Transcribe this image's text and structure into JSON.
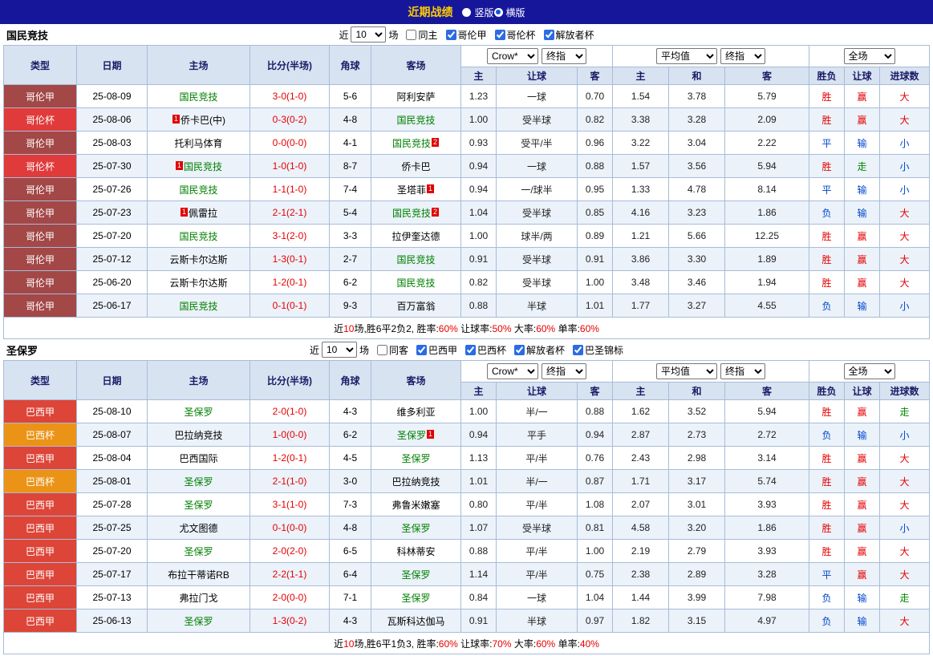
{
  "topbar": {
    "title": "近期战绩",
    "radios": [
      {
        "label": "竖版",
        "selected": false
      },
      {
        "label": "横版",
        "selected": true
      }
    ]
  },
  "columns": {
    "left": [
      "类型",
      "日期",
      "主场",
      "比分(半场)",
      "角球",
      "客场"
    ],
    "selects": {
      "odds_source": "Crow*",
      "odds_time": "终指",
      "avg_source": "平均值",
      "avg_time": "终指",
      "scope": "全场"
    },
    "odds_cols": [
      "主",
      "让球",
      "客"
    ],
    "avg_cols": [
      "主",
      "和",
      "客"
    ],
    "result_cols": [
      "胜负",
      "让球",
      "进球数"
    ]
  },
  "league_colors": {
    "哥伦甲": "#a34747",
    "哥伦杯": "#e03a3a",
    "巴西甲": "#dd4538",
    "巴西杯": "#eb9316"
  },
  "result_colors": {
    "red": "#e60000",
    "blue": "#0046cc",
    "green": "#008800"
  },
  "sections": [
    {
      "team": "国民竞技",
      "filter": {
        "prefix": "近",
        "count": "10",
        "suffix": "场",
        "checkboxes": [
          {
            "label": "同主",
            "checked": false
          },
          {
            "label": "哥伦甲",
            "checked": true
          },
          {
            "label": "哥伦杯",
            "checked": true
          },
          {
            "label": "解放者杯",
            "checked": true
          }
        ]
      },
      "rows": [
        {
          "league": "哥伦甲",
          "date": "25-08-09",
          "home": {
            "name": "国民竞技",
            "green": true
          },
          "score": "3-0(1-0)",
          "corner": "5-6",
          "away": {
            "name": "阿利安萨",
            "green": false
          },
          "odds": [
            "1.23",
            "一球",
            "0.70"
          ],
          "avg": [
            "1.54",
            "3.78",
            "5.79"
          ],
          "results": [
            {
              "t": "胜",
              "c": "red"
            },
            {
              "t": "赢",
              "c": "red"
            },
            {
              "t": "大",
              "c": "red"
            }
          ]
        },
        {
          "league": "哥伦杯",
          "date": "25-08-06",
          "home": {
            "name": "侨卡巴(中)",
            "green": false,
            "badge_pre": "1"
          },
          "score": "0-3(0-2)",
          "corner": "4-8",
          "away": {
            "name": "国民竞技",
            "green": true
          },
          "odds": [
            "1.00",
            "受半球",
            "0.82"
          ],
          "avg": [
            "3.38",
            "3.28",
            "2.09"
          ],
          "results": [
            {
              "t": "胜",
              "c": "red"
            },
            {
              "t": "赢",
              "c": "red"
            },
            {
              "t": "大",
              "c": "red"
            }
          ]
        },
        {
          "league": "哥伦甲",
          "date": "25-08-03",
          "home": {
            "name": "托利马体育",
            "green": false
          },
          "score": "0-0(0-0)",
          "corner": "4-1",
          "away": {
            "name": "国民竞技",
            "green": true,
            "badge_post": "2"
          },
          "odds": [
            "0.93",
            "受平/半",
            "0.96"
          ],
          "avg": [
            "3.22",
            "3.04",
            "2.22"
          ],
          "results": [
            {
              "t": "平",
              "c": "blue"
            },
            {
              "t": "输",
              "c": "blue"
            },
            {
              "t": "小",
              "c": "blue"
            }
          ]
        },
        {
          "league": "哥伦杯",
          "date": "25-07-30",
          "home": {
            "name": "国民竞技",
            "green": true,
            "badge_pre": "1"
          },
          "score": "1-0(1-0)",
          "corner": "8-7",
          "away": {
            "name": "侨卡巴",
            "green": false
          },
          "odds": [
            "0.94",
            "一球",
            "0.88"
          ],
          "avg": [
            "1.57",
            "3.56",
            "5.94"
          ],
          "results": [
            {
              "t": "胜",
              "c": "red"
            },
            {
              "t": "走",
              "c": "green"
            },
            {
              "t": "小",
              "c": "blue"
            }
          ]
        },
        {
          "league": "哥伦甲",
          "date": "25-07-26",
          "home": {
            "name": "国民竞技",
            "green": true
          },
          "score": "1-1(1-0)",
          "corner": "7-4",
          "away": {
            "name": "圣塔菲",
            "green": false,
            "badge_post": "1"
          },
          "odds": [
            "0.94",
            "一/球半",
            "0.95"
          ],
          "avg": [
            "1.33",
            "4.78",
            "8.14"
          ],
          "results": [
            {
              "t": "平",
              "c": "blue"
            },
            {
              "t": "输",
              "c": "blue"
            },
            {
              "t": "小",
              "c": "blue"
            }
          ]
        },
        {
          "league": "哥伦甲",
          "date": "25-07-23",
          "home": {
            "name": "佩雷拉",
            "green": false,
            "badge_pre": "1"
          },
          "score": "2-1(2-1)",
          "corner": "5-4",
          "away": {
            "name": "国民竞技",
            "green": true,
            "badge_post": "2"
          },
          "odds": [
            "1.04",
            "受半球",
            "0.85"
          ],
          "avg": [
            "4.16",
            "3.23",
            "1.86"
          ],
          "results": [
            {
              "t": "负",
              "c": "blue"
            },
            {
              "t": "输",
              "c": "blue"
            },
            {
              "t": "大",
              "c": "red"
            }
          ]
        },
        {
          "league": "哥伦甲",
          "date": "25-07-20",
          "home": {
            "name": "国民竞技",
            "green": true
          },
          "score": "3-1(2-0)",
          "corner": "3-3",
          "away": {
            "name": "拉伊奎达德",
            "green": false
          },
          "odds": [
            "1.00",
            "球半/两",
            "0.89"
          ],
          "avg": [
            "1.21",
            "5.66",
            "12.25"
          ],
          "results": [
            {
              "t": "胜",
              "c": "red"
            },
            {
              "t": "赢",
              "c": "red"
            },
            {
              "t": "大",
              "c": "red"
            }
          ]
        },
        {
          "league": "哥伦甲",
          "date": "25-07-12",
          "home": {
            "name": "云斯卡尔达斯",
            "green": false
          },
          "score": "1-3(0-1)",
          "corner": "2-7",
          "away": {
            "name": "国民竞技",
            "green": true
          },
          "odds": [
            "0.91",
            "受半球",
            "0.91"
          ],
          "avg": [
            "3.86",
            "3.30",
            "1.89"
          ],
          "results": [
            {
              "t": "胜",
              "c": "red"
            },
            {
              "t": "赢",
              "c": "red"
            },
            {
              "t": "大",
              "c": "red"
            }
          ]
        },
        {
          "league": "哥伦甲",
          "date": "25-06-20",
          "home": {
            "name": "云斯卡尔达斯",
            "green": false
          },
          "score": "1-2(0-1)",
          "corner": "6-2",
          "away": {
            "name": "国民竞技",
            "green": true
          },
          "odds": [
            "0.82",
            "受半球",
            "1.00"
          ],
          "avg": [
            "3.48",
            "3.46",
            "1.94"
          ],
          "results": [
            {
              "t": "胜",
              "c": "red"
            },
            {
              "t": "赢",
              "c": "red"
            },
            {
              "t": "大",
              "c": "red"
            }
          ]
        },
        {
          "league": "哥伦甲",
          "date": "25-06-17",
          "home": {
            "name": "国民竞技",
            "green": true
          },
          "score": "0-1(0-1)",
          "corner": "9-3",
          "away": {
            "name": "百万富翁",
            "green": false
          },
          "odds": [
            "0.88",
            "半球",
            "1.01"
          ],
          "avg": [
            "1.77",
            "3.27",
            "4.55"
          ],
          "results": [
            {
              "t": "负",
              "c": "blue"
            },
            {
              "t": "输",
              "c": "blue"
            },
            {
              "t": "小",
              "c": "blue"
            }
          ]
        }
      ],
      "summary": [
        {
          "t": "近"
        },
        {
          "t": "10",
          "red": true
        },
        {
          "t": "场,胜6平2负2, 胜率:"
        },
        {
          "t": "60%",
          "red": true
        },
        {
          "t": " 让球率:"
        },
        {
          "t": "50%",
          "red": true
        },
        {
          "t": " 大率:"
        },
        {
          "t": "60%",
          "red": true
        },
        {
          "t": " 单率:"
        },
        {
          "t": "60%",
          "red": true
        }
      ]
    },
    {
      "team": "圣保罗",
      "filter": {
        "prefix": "近",
        "count": "10",
        "suffix": "场",
        "checkboxes": [
          {
            "label": "同客",
            "checked": false
          },
          {
            "label": "巴西甲",
            "checked": true
          },
          {
            "label": "巴西杯",
            "checked": true
          },
          {
            "label": "解放者杯",
            "checked": true
          },
          {
            "label": "巴圣锦标",
            "checked": true
          }
        ]
      },
      "rows": [
        {
          "league": "巴西甲",
          "date": "25-08-10",
          "home": {
            "name": "圣保罗",
            "green": true
          },
          "score": "2-0(1-0)",
          "corner": "4-3",
          "away": {
            "name": "维多利亚",
            "green": false
          },
          "odds": [
            "1.00",
            "半/一",
            "0.88"
          ],
          "avg": [
            "1.62",
            "3.52",
            "5.94"
          ],
          "results": [
            {
              "t": "胜",
              "c": "red"
            },
            {
              "t": "赢",
              "c": "red"
            },
            {
              "t": "走",
              "c": "green"
            }
          ]
        },
        {
          "league": "巴西杯",
          "date": "25-08-07",
          "home": {
            "name": "巴拉纳竞技",
            "green": false
          },
          "score": "1-0(0-0)",
          "corner": "6-2",
          "away": {
            "name": "圣保罗",
            "green": true,
            "badge_post": "1"
          },
          "odds": [
            "0.94",
            "平手",
            "0.94"
          ],
          "avg": [
            "2.87",
            "2.73",
            "2.72"
          ],
          "results": [
            {
              "t": "负",
              "c": "blue"
            },
            {
              "t": "输",
              "c": "blue"
            },
            {
              "t": "小",
              "c": "blue"
            }
          ]
        },
        {
          "league": "巴西甲",
          "date": "25-08-04",
          "home": {
            "name": "巴西国际",
            "green": false
          },
          "score": "1-2(0-1)",
          "corner": "4-5",
          "away": {
            "name": "圣保罗",
            "green": true
          },
          "odds": [
            "1.13",
            "平/半",
            "0.76"
          ],
          "avg": [
            "2.43",
            "2.98",
            "3.14"
          ],
          "results": [
            {
              "t": "胜",
              "c": "red"
            },
            {
              "t": "赢",
              "c": "red"
            },
            {
              "t": "大",
              "c": "red"
            }
          ]
        },
        {
          "league": "巴西杯",
          "date": "25-08-01",
          "home": {
            "name": "圣保罗",
            "green": true
          },
          "score": "2-1(1-0)",
          "corner": "3-0",
          "away": {
            "name": "巴拉纳竞技",
            "green": false
          },
          "odds": [
            "1.01",
            "半/一",
            "0.87"
          ],
          "avg": [
            "1.71",
            "3.17",
            "5.74"
          ],
          "results": [
            {
              "t": "胜",
              "c": "red"
            },
            {
              "t": "赢",
              "c": "red"
            },
            {
              "t": "大",
              "c": "red"
            }
          ]
        },
        {
          "league": "巴西甲",
          "date": "25-07-28",
          "home": {
            "name": "圣保罗",
            "green": true
          },
          "score": "3-1(1-0)",
          "corner": "7-3",
          "away": {
            "name": "弗鲁米嫩塞",
            "green": false
          },
          "odds": [
            "0.80",
            "平/半",
            "1.08"
          ],
          "avg": [
            "2.07",
            "3.01",
            "3.93"
          ],
          "results": [
            {
              "t": "胜",
              "c": "red"
            },
            {
              "t": "赢",
              "c": "red"
            },
            {
              "t": "大",
              "c": "red"
            }
          ]
        },
        {
          "league": "巴西甲",
          "date": "25-07-25",
          "home": {
            "name": "尤文图德",
            "green": false
          },
          "score": "0-1(0-0)",
          "corner": "4-8",
          "away": {
            "name": "圣保罗",
            "green": true
          },
          "odds": [
            "1.07",
            "受半球",
            "0.81"
          ],
          "avg": [
            "4.58",
            "3.20",
            "1.86"
          ],
          "results": [
            {
              "t": "胜",
              "c": "red"
            },
            {
              "t": "赢",
              "c": "red"
            },
            {
              "t": "小",
              "c": "blue"
            }
          ]
        },
        {
          "league": "巴西甲",
          "date": "25-07-20",
          "home": {
            "name": "圣保罗",
            "green": true
          },
          "score": "2-0(2-0)",
          "corner": "6-5",
          "away": {
            "name": "科林蒂安",
            "green": false
          },
          "odds": [
            "0.88",
            "平/半",
            "1.00"
          ],
          "avg": [
            "2.19",
            "2.79",
            "3.93"
          ],
          "results": [
            {
              "t": "胜",
              "c": "red"
            },
            {
              "t": "赢",
              "c": "red"
            },
            {
              "t": "大",
              "c": "red"
            }
          ]
        },
        {
          "league": "巴西甲",
          "date": "25-07-17",
          "home": {
            "name": "布拉干蒂诺RB",
            "green": false
          },
          "score": "2-2(1-1)",
          "corner": "6-4",
          "away": {
            "name": "圣保罗",
            "green": true
          },
          "odds": [
            "1.14",
            "平/半",
            "0.75"
          ],
          "avg": [
            "2.38",
            "2.89",
            "3.28"
          ],
          "results": [
            {
              "t": "平",
              "c": "blue"
            },
            {
              "t": "赢",
              "c": "red"
            },
            {
              "t": "大",
              "c": "red"
            }
          ]
        },
        {
          "league": "巴西甲",
          "date": "25-07-13",
          "home": {
            "name": "弗拉门戈",
            "green": false
          },
          "score": "2-0(0-0)",
          "corner": "7-1",
          "away": {
            "name": "圣保罗",
            "green": true
          },
          "odds": [
            "0.84",
            "一球",
            "1.04"
          ],
          "avg": [
            "1.44",
            "3.99",
            "7.98"
          ],
          "results": [
            {
              "t": "负",
              "c": "blue"
            },
            {
              "t": "输",
              "c": "blue"
            },
            {
              "t": "走",
              "c": "green"
            }
          ]
        },
        {
          "league": "巴西甲",
          "date": "25-06-13",
          "home": {
            "name": "圣保罗",
            "green": true
          },
          "score": "1-3(0-2)",
          "corner": "4-3",
          "away": {
            "name": "瓦斯科达伽马",
            "green": false
          },
          "odds": [
            "0.91",
            "半球",
            "0.97"
          ],
          "avg": [
            "1.82",
            "3.15",
            "4.97"
          ],
          "results": [
            {
              "t": "负",
              "c": "blue"
            },
            {
              "t": "输",
              "c": "blue"
            },
            {
              "t": "大",
              "c": "red"
            }
          ]
        }
      ],
      "summary": [
        {
          "t": "近"
        },
        {
          "t": "10",
          "red": true
        },
        {
          "t": "场,胜6平1负3, 胜率:"
        },
        {
          "t": "60%",
          "red": true
        },
        {
          "t": " 让球率:"
        },
        {
          "t": "70%",
          "red": true
        },
        {
          "t": " 大率:"
        },
        {
          "t": "60%",
          "red": true
        },
        {
          "t": " 单率:"
        },
        {
          "t": "40%",
          "red": true
        }
      ]
    }
  ]
}
